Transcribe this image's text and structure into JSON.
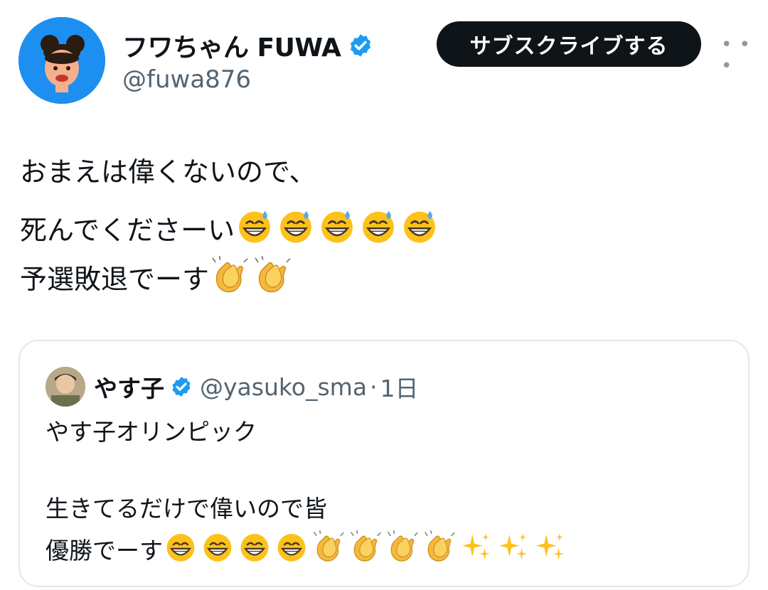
{
  "author": {
    "display_name": "フワちゃん FUWA",
    "handle": "@fuwa876",
    "verified": true,
    "avatar_bg": "#1d8ff0"
  },
  "actions": {
    "subscribe_label": "サブスクライブする",
    "more_icon": "more-horizontal-icon"
  },
  "tweet": {
    "lines": [
      {
        "text": "おまえは偉くないので、",
        "emojis": []
      },
      {
        "text": "死んでくださーい",
        "emojis": [
          "grinning-sweat",
          "grinning-sweat",
          "grinning-sweat",
          "grinning-sweat",
          "grinning-sweat"
        ]
      },
      {
        "text": "予選敗退でーす",
        "emojis": [
          "clapping-hands",
          "clapping-hands"
        ]
      }
    ]
  },
  "quote": {
    "display_name": "やす子",
    "handle": "@yasuko_sma",
    "separator": "·",
    "time": "1日",
    "verified": true,
    "lines": [
      {
        "text": "やす子オリンピック",
        "emojis": []
      },
      {
        "text": "生きてるだけで偉いので皆",
        "emojis": []
      },
      {
        "text": "優勝でーす",
        "emojis": [
          "grinning-smile",
          "grinning-smile",
          "grinning-smile",
          "grinning-smile",
          "clapping-hands",
          "clapping-hands",
          "clapping-hands",
          "clapping-hands",
          "sparkles",
          "sparkles",
          "sparkles"
        ]
      }
    ]
  },
  "colors": {
    "verified_blue": "#1d9bf0",
    "text_primary": "#0f1419",
    "text_secondary": "#536471",
    "button_bg": "#0f1419",
    "card_border": "#e3e8ec"
  }
}
